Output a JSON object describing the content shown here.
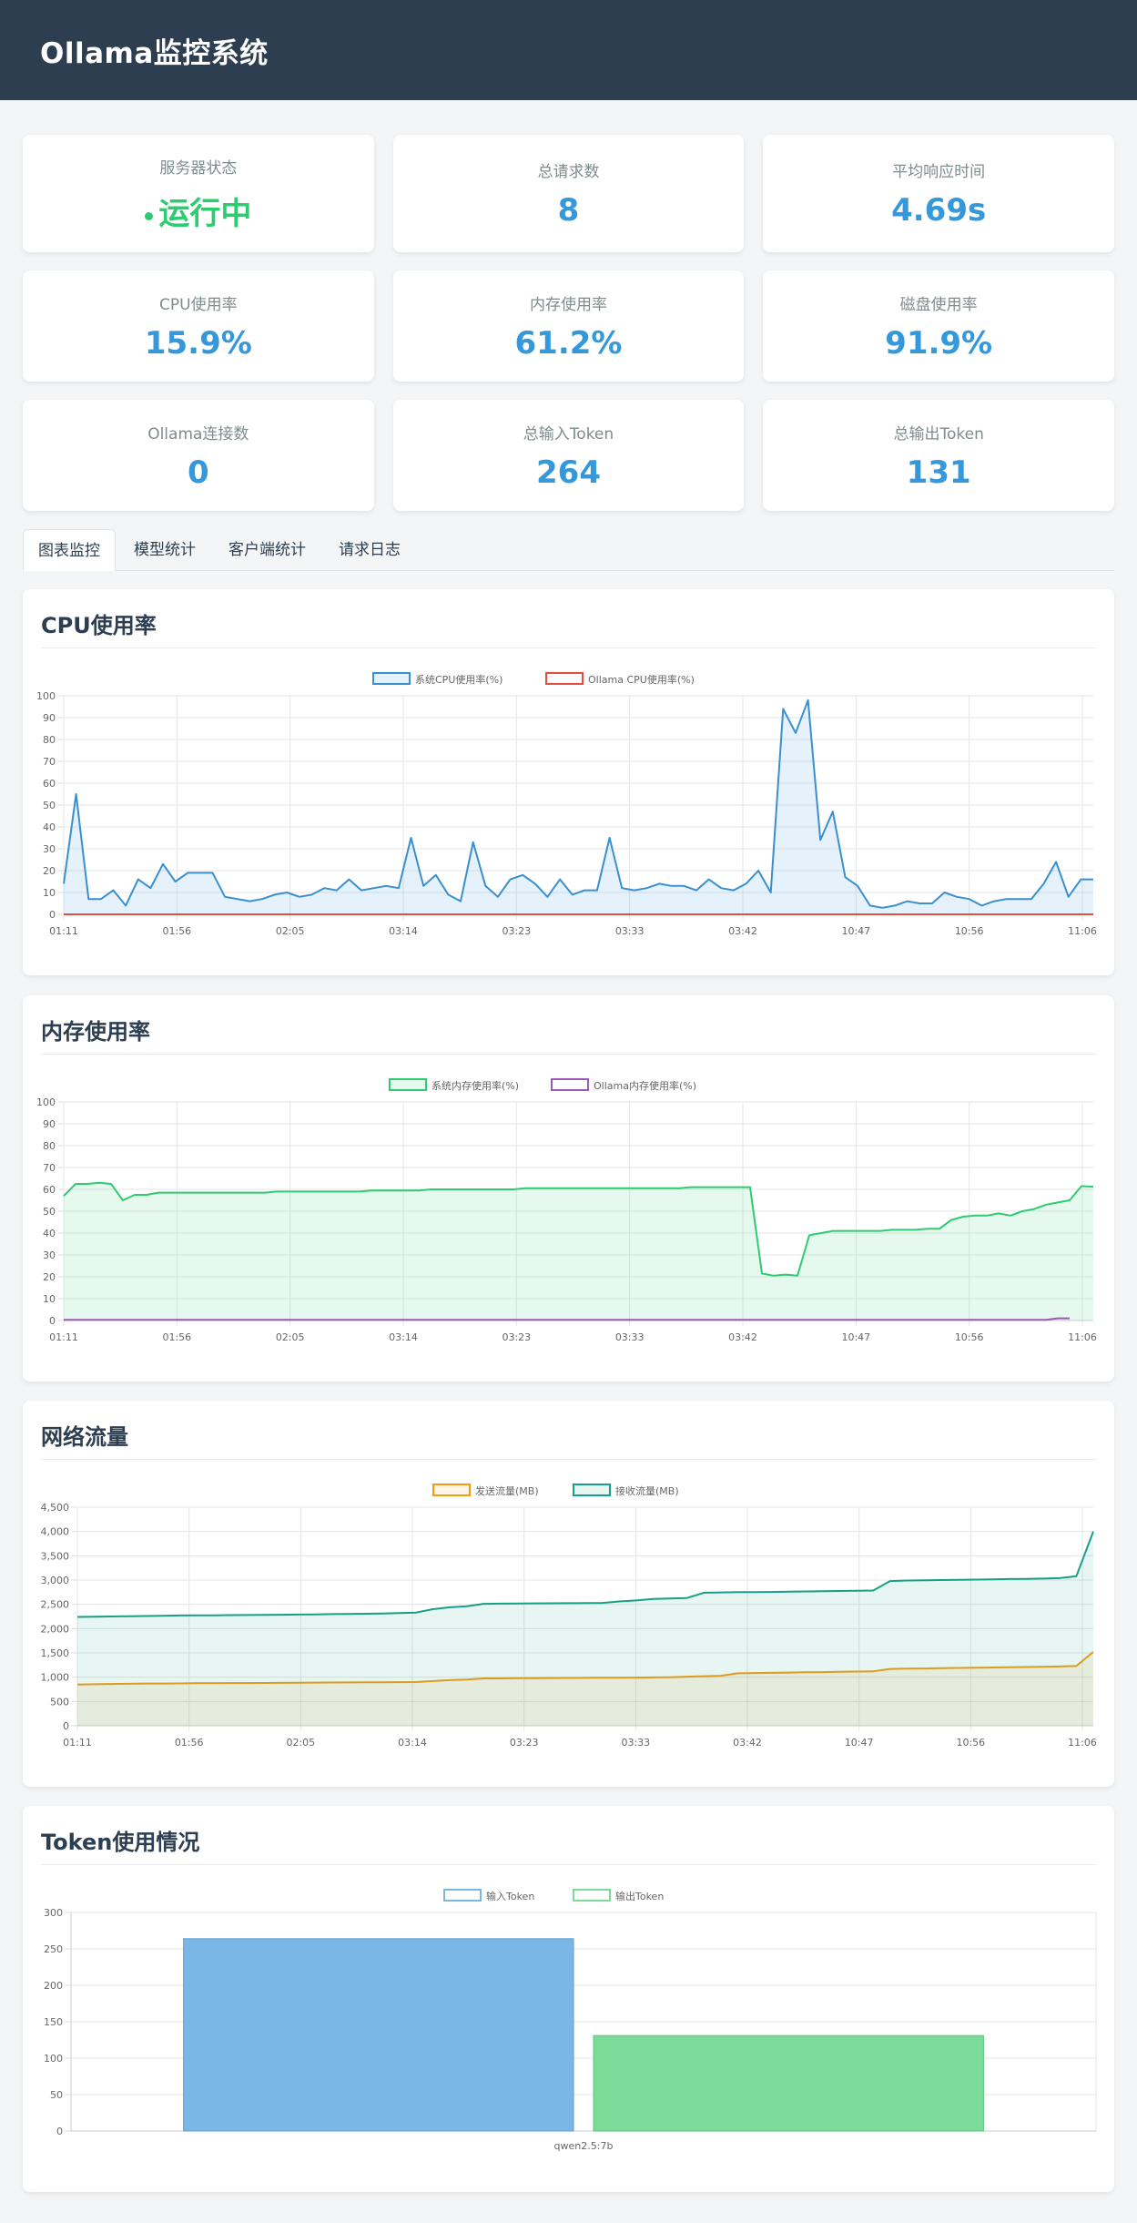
{
  "app": {
    "title": "Ollama监控系统"
  },
  "stats": [
    {
      "label": "服务器状态",
      "value": "运行中"
    },
    {
      "label": "总请求数",
      "value": "8"
    },
    {
      "label": "平均响应时间",
      "value": "4.69s"
    },
    {
      "label": "CPU使用率",
      "value": "15.9%"
    },
    {
      "label": "内存使用率",
      "value": "61.2%"
    },
    {
      "label": "磁盘使用率",
      "value": "91.9%"
    },
    {
      "label": "Ollama连接数",
      "value": "0"
    },
    {
      "label": "总输入Token",
      "value": "264"
    },
    {
      "label": "总输出Token",
      "value": "131"
    }
  ],
  "tabs": [
    {
      "label": "图表监控",
      "active": true
    },
    {
      "label": "模型统计"
    },
    {
      "label": "客户端统计"
    },
    {
      "label": "请求日志"
    }
  ],
  "colors": {
    "header": "#2c3e50",
    "accent": "#3498db",
    "ok": "#2ecc71"
  },
  "chart_data": [
    {
      "panel_title": "CPU使用率",
      "type": "line",
      "x_ticks": [
        "01:11",
        "01:56",
        "02:05",
        "03:14",
        "03:23",
        "03:33",
        "03:42",
        "10:47",
        "10:56",
        "11:06"
      ],
      "ylim": [
        0,
        100
      ],
      "y_ticks": [
        0,
        10,
        20,
        30,
        40,
        50,
        60,
        70,
        80,
        90,
        100
      ],
      "legend_position": "top-center",
      "grid": true,
      "series": [
        {
          "name": "系统CPU使用率(%)",
          "color": "#3a8fce",
          "fill": "rgba(52,152,219,0.12)",
          "values": [
            14,
            55,
            7,
            7,
            11,
            4,
            16,
            12,
            23,
            15,
            19,
            19,
            19,
            8,
            7,
            6,
            7,
            9,
            10,
            8,
            9,
            12,
            11,
            16,
            11,
            12,
            13,
            12,
            35,
            13,
            18,
            9,
            6,
            33,
            13,
            8,
            16,
            18,
            14,
            8,
            16,
            9,
            11,
            11,
            35,
            12,
            11,
            12,
            14,
            13,
            13,
            11,
            16,
            12,
            11,
            14,
            20,
            10,
            94,
            83,
            98,
            34,
            47,
            17,
            13,
            4,
            3,
            4,
            6,
            5,
            5,
            10,
            8,
            7,
            4,
            6,
            7,
            7,
            7,
            14,
            24,
            8,
            16,
            16
          ]
        },
        {
          "name": "Ollama CPU使用率(%)",
          "color": "#e74c3c",
          "fill": "none",
          "values": [
            0,
            0,
            0,
            0,
            0,
            0,
            0,
            0,
            0,
            0,
            0,
            0,
            0,
            0,
            0,
            0,
            0,
            0,
            0,
            0,
            0,
            0,
            0,
            0,
            0,
            0,
            0,
            0,
            0,
            0,
            0,
            0,
            0,
            0,
            0,
            0,
            0,
            0,
            0,
            0,
            0,
            0,
            0,
            0,
            0,
            0,
            0,
            0,
            0,
            0,
            0,
            0,
            0,
            0,
            0,
            0,
            0,
            0,
            0,
            0,
            0,
            0,
            0,
            0,
            0,
            0,
            0,
            0,
            0,
            0,
            0,
            0,
            0,
            0,
            0,
            0,
            0,
            0,
            0,
            0,
            0,
            0,
            0,
            0
          ]
        }
      ]
    },
    {
      "panel_title": "内存使用率",
      "type": "line",
      "x_ticks": [
        "01:11",
        "01:56",
        "02:05",
        "03:14",
        "03:23",
        "03:33",
        "03:42",
        "10:47",
        "10:56",
        "11:06"
      ],
      "ylim": [
        0,
        100
      ],
      "y_ticks": [
        0,
        10,
        20,
        30,
        40,
        50,
        60,
        70,
        80,
        90,
        100
      ],
      "legend_position": "top-center",
      "grid": true,
      "series": [
        {
          "name": "系统内存使用率(%)",
          "color": "#2ecc71",
          "fill": "rgba(46,204,113,0.12)",
          "values": [
            57,
            62.5,
            62.5,
            63,
            62.5,
            55,
            57.5,
            57.5,
            58.5,
            58.5,
            58.5,
            58.5,
            58.5,
            58.5,
            58.5,
            58.5,
            58.5,
            58.5,
            59,
            59,
            59,
            59,
            59,
            59,
            59,
            59,
            59.5,
            59.5,
            59.5,
            59.5,
            59.5,
            60,
            60,
            60,
            60,
            60,
            60,
            60,
            60,
            60.5,
            60.5,
            60.5,
            60.5,
            60.5,
            60.5,
            60.5,
            60.5,
            60.5,
            60.5,
            60.5,
            60.5,
            60.5,
            60.5,
            61,
            61,
            61,
            61,
            61,
            61,
            21.5,
            20.5,
            21,
            20.5,
            39,
            40,
            41,
            41,
            41,
            41,
            41,
            41.5,
            41.5,
            41.5,
            42,
            42,
            46,
            47.5,
            48,
            48,
            49,
            48,
            50,
            51,
            53,
            54,
            55,
            61.5,
            61.2
          ]
        },
        {
          "name": "Ollama内存使用率(%)",
          "color": "#9b59b6",
          "fill": "none",
          "values": [
            0.3,
            0.3,
            0.3,
            0.3,
            0.3,
            0.3,
            0.3,
            0.3,
            0.3,
            0.3,
            0.3,
            0.3,
            0.3,
            0.3,
            0.3,
            0.3,
            0.3,
            0.3,
            0.3,
            0.3,
            0.3,
            0.3,
            0.3,
            0.3,
            0.3,
            0.3,
            0.3,
            0.3,
            0.3,
            0.3,
            0.3,
            0.3,
            0.3,
            0.3,
            0.3,
            0.3,
            0.3,
            0.3,
            0.3,
            0.3,
            0.3,
            0.3,
            0.3,
            0.3,
            0.3,
            0.3,
            0.3,
            0.3,
            0.3,
            0.3,
            0.3,
            0.3,
            0.3,
            0.3,
            0.3,
            0.3,
            0.3,
            0.3,
            0.3,
            0.3,
            0.3,
            0.3,
            0.3,
            0.3,
            0.3,
            0.3,
            0.3,
            0.3,
            0.3,
            0.3,
            0.3,
            0.3,
            0.3,
            0.3,
            0.3,
            0.3,
            0.3,
            0.3,
            0.3,
            0.3,
            0.3,
            0.3,
            0.3,
            0.3,
            1,
            1
          ]
        }
      ]
    },
    {
      "panel_title": "网络流量",
      "type": "line",
      "x_ticks": [
        "01:11",
        "01:56",
        "02:05",
        "03:14",
        "03:23",
        "03:33",
        "03:42",
        "10:47",
        "10:56",
        "11:06"
      ],
      "ylim": [
        0,
        4500
      ],
      "y_ticks": [
        0,
        500,
        1000,
        1500,
        2000,
        2500,
        3000,
        3500,
        4000,
        4500
      ],
      "y_tick_labels": [
        "0",
        "500",
        "1,000",
        "1,500",
        "2,000",
        "2,500",
        "3,000",
        "3,500",
        "4,000",
        "4,500"
      ],
      "legend_position": "top-center",
      "grid": true,
      "series": [
        {
          "name": "发送流量(MB)",
          "color": "#f39c12",
          "fill": "rgba(243,156,18,0.10)",
          "values": [
            850,
            855,
            860,
            865,
            870,
            870,
            872,
            875,
            878,
            880,
            880,
            882,
            884,
            886,
            888,
            890,
            892,
            894,
            896,
            898,
            900,
            920,
            940,
            950,
            975,
            975,
            980,
            980,
            982,
            984,
            986,
            988,
            990,
            992,
            995,
            1000,
            1010,
            1020,
            1030,
            1080,
            1085,
            1090,
            1095,
            1100,
            1105,
            1110,
            1115,
            1120,
            1170,
            1175,
            1180,
            1185,
            1190,
            1195,
            1200,
            1205,
            1210,
            1215,
            1220,
            1230,
            1520
          ]
        },
        {
          "name": "接收流量(MB)",
          "color": "#16a085",
          "fill": "rgba(22,160,133,0.10)",
          "values": [
            2240,
            2245,
            2250,
            2255,
            2260,
            2265,
            2270,
            2272,
            2275,
            2278,
            2280,
            2283,
            2286,
            2290,
            2294,
            2298,
            2302,
            2306,
            2310,
            2320,
            2330,
            2400,
            2440,
            2460,
            2510,
            2515,
            2518,
            2520,
            2522,
            2524,
            2526,
            2530,
            2560,
            2580,
            2610,
            2620,
            2630,
            2740,
            2745,
            2750,
            2752,
            2755,
            2760,
            2765,
            2770,
            2775,
            2780,
            2785,
            2980,
            2990,
            2995,
            3000,
            3005,
            3010,
            3015,
            3020,
            3025,
            3030,
            3040,
            3080,
            4000
          ]
        }
      ]
    },
    {
      "panel_title": "Token使用情况",
      "type": "bar",
      "categories": [
        "qwen2.5:7b"
      ],
      "ylim": [
        0,
        300
      ],
      "y_ticks": [
        0,
        50,
        100,
        150,
        200,
        250,
        300
      ],
      "legend_position": "top-center",
      "grid": true,
      "series": [
        {
          "name": "输入Token",
          "color": "#7ab6e6",
          "border": "#5c9fd6",
          "values": [
            264
          ]
        },
        {
          "name": "输出Token",
          "color": "#7ddb9a",
          "border": "#56c77a",
          "values": [
            131
          ]
        }
      ]
    }
  ]
}
